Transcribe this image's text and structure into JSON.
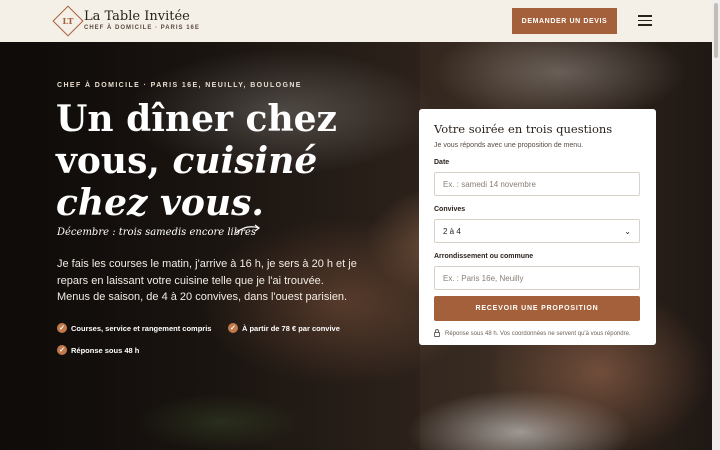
{
  "header": {
    "logo_initials": "LT",
    "brand_name": "La Table Invitée",
    "brand_sub": "CHEF À DOMICILE · PARIS 16E",
    "cta_label": "DEMANDER UN DEVIS",
    "menu_icon": "hamburger-icon"
  },
  "hero": {
    "eyebrow": "CHEF À DOMICILE · PARIS 16E, NEUILLY, BOULOGNE",
    "headline_1": "Un dîner chez",
    "headline_2": "vous, ",
    "headline_2_em": "cuisiné",
    "headline_3_em": "chez vous.",
    "handnote": "Décembre : trois samedis encore libres",
    "intro": "Je fais les courses le matin, j'arrive à 16 h, je sers à 20 h et je repars en laissant votre cuisine telle que je l'ai trouvée. Menus de saison, de 4 à 20 convives, dans l'ouest parisien.",
    "checks": [
      "Courses, service et rangement compris",
      "À partir de 78 € par convive",
      "Réponse sous 48 h"
    ]
  },
  "form": {
    "title": "Votre soirée en trois questions",
    "subtitle": "Je vous réponds avec une proposition de menu.",
    "date_label": "Date",
    "date_placeholder": "Ex. : samedi 14 novembre",
    "guests_label": "Convives",
    "guests_value": "2 à 4",
    "area_label": "Arrondissement ou commune",
    "area_placeholder": "Ex. : Paris 16e, Neuilly",
    "submit_label": "RECEVOIR UNE PROPOSITION",
    "privacy": "Réponse sous 48 h. Vos coordonnées ne servent qu'à vous répondre."
  },
  "colors": {
    "accent": "#a4603a",
    "header_bg": "#f4efe7",
    "check": "#c07a4c"
  }
}
